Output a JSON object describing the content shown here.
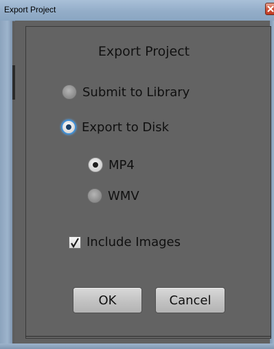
{
  "window": {
    "title": "Export Project"
  },
  "dialog": {
    "heading": "Export Project",
    "options": {
      "submit_to_library": "Submit to Library",
      "export_to_disk": "Export to Disk",
      "selected": "export_to_disk"
    },
    "format": {
      "mp4": "MP4",
      "wmv": "WMV",
      "selected": "mp4"
    },
    "include_images": {
      "label": "Include Images",
      "checked": true
    },
    "buttons": {
      "ok": "OK",
      "cancel": "Cancel"
    }
  },
  "colors": {
    "panel_bg": "#616161",
    "focus_ring": "#3f8fd6",
    "title_bar": "#9db4cc"
  }
}
